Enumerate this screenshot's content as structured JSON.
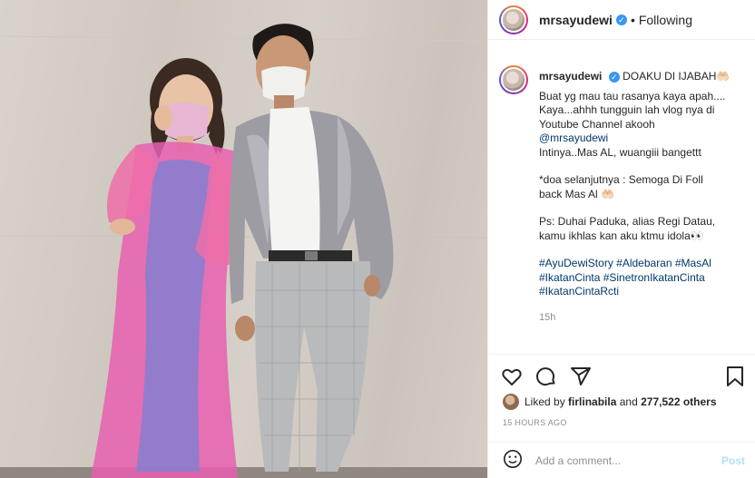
{
  "post": {
    "username": "mrsayudewi",
    "follow_status": "Following",
    "verified_glyph": "✓",
    "separator": "•"
  },
  "caption": {
    "username": "mrsayudewi",
    "title": "DOAKU DI IJABAH🤲🏻",
    "lines": [
      "Buat yg mau tau rasanya kaya apah....",
      "Kaya...ahhh tungguin lah vlog nya di",
      "Youtube Channel akooh"
    ],
    "mention": "@mrsayudewi",
    "line_after_mention": "Intinya..Mas AL, wuangiii bangettt",
    "doa_line1": "*doa selanjutnya : Semoga Di Foll",
    "doa_line2": "back Mas Al 🤲🏻",
    "ps_line1": "Ps: Duhai Paduka, alias Regi Datau,",
    "ps_line2": "kamu ikhlas kan aku ktmu idola👀",
    "hashtags_line1": "#AyuDewiStory #Aldebaran #MasAl",
    "hashtags_line2": "#IkatanCinta #SinetronIkatanCinta",
    "hashtags_line3": "#IkatanCintaRcti",
    "age": "15h"
  },
  "actions": {
    "liked_by_prefix": "Liked by",
    "liked_by_user": "firlinabila",
    "and_word": "and",
    "others_count": "277,522 others",
    "timestamp": "15 HOURS AGO"
  },
  "comment": {
    "placeholder": "Add a comment...",
    "post_label": "Post"
  },
  "icons": [
    "heart-icon",
    "comment-icon",
    "share-icon",
    "bookmark-icon",
    "emoji-icon"
  ],
  "colors": {
    "link": "#00376b",
    "verified": "#3897f0",
    "post_button_disabled": "#b2dffc",
    "muted": "#8e8e8e"
  }
}
